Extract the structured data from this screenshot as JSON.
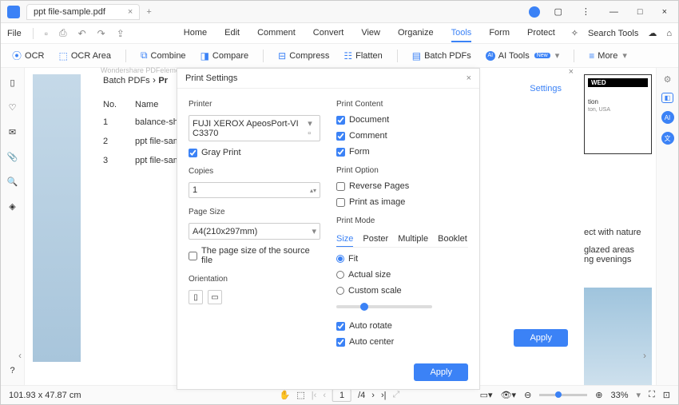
{
  "titlebar": {
    "tab_name": "ppt file-sample.pdf"
  },
  "menubar": {
    "file": "File",
    "items": [
      "Home",
      "Edit",
      "Comment",
      "Convert",
      "View",
      "Organize",
      "Tools",
      "Form",
      "Protect"
    ],
    "search_ph": "Search Tools"
  },
  "toolbar": {
    "ocr": "OCR",
    "ocr_area": "OCR Area",
    "combine": "Combine",
    "compare": "Compare",
    "compress": "Compress",
    "flatten": "Flatten",
    "batch": "Batch PDFs",
    "ai": "AI Tools",
    "more": "More"
  },
  "breadcrumb": {
    "a": "Batch PDFs",
    "b": "Pr"
  },
  "table": {
    "hdr_no": "No.",
    "hdr_name": "Name",
    "rows": [
      {
        "no": "1",
        "name": "balance-she"
      },
      {
        "no": "2",
        "name": "ppt file-sam"
      },
      {
        "no": "3",
        "name": "ppt file-sam"
      }
    ]
  },
  "settings_link": "Settings",
  "watermark": "Wondershare PDFelement",
  "dlg": {
    "title": "Print Settings",
    "printer_lbl": "Printer",
    "printer_val": "FUJI XEROX ApeosPort-VI C3370",
    "gray": "Gray Print",
    "copies_lbl": "Copies",
    "copies_val": "1",
    "page_size_lbl": "Page Size",
    "page_size_val": "A4(210x297mm)",
    "src_file": "The page size of the source file",
    "orient_lbl": "Orientation",
    "content_lbl": "Print Content",
    "content_doc": "Document",
    "content_cmt": "Comment",
    "content_frm": "Form",
    "option_lbl": "Print Option",
    "reverse": "Reverse Pages",
    "as_image": "Print as image",
    "mode_lbl": "Print Mode",
    "tabs": [
      "Size",
      "Poster",
      "Multiple",
      "Booklet"
    ],
    "fit": "Fit",
    "actual": "Actual size",
    "custom": "Custom scale",
    "auto_rotate": "Auto rotate",
    "auto_center": "Auto center",
    "apply": "Apply"
  },
  "panel": {
    "apply": "Apply"
  },
  "status": {
    "coords": "101.93 x 47.87 cm",
    "page": "1",
    "pages": "/4",
    "zoom": "33%"
  },
  "bg": {
    "wed": "WED",
    "tion": "tion",
    "loc": "ton, USA",
    "txt1": "ect with nature",
    "txt2": "glazed areas",
    "txt3": "ng evenings"
  }
}
